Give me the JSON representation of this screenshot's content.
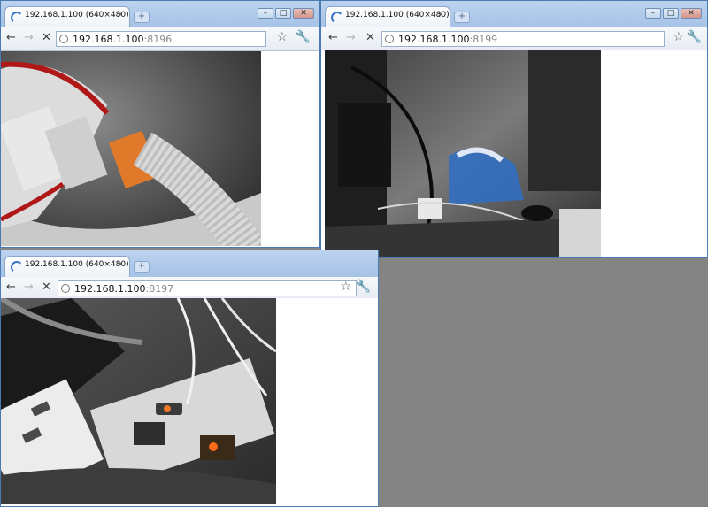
{
  "windows": [
    {
      "tab_title": "192.168.1.100 (640×480)",
      "tab_close": "×",
      "new_tab": "+",
      "url_host": "192.168.1.100",
      "url_port": ":8196",
      "icons": [
        "back-arrow-icon",
        "forward-arrow-icon",
        "stop-icon",
        "globe-icon",
        "star-icon",
        "wrench-icon"
      ]
    },
    {
      "tab_title": "192.168.1.100 (640×480)",
      "tab_close": "×",
      "new_tab": "+",
      "url_host": "192.168.1.100",
      "url_port": ":8199",
      "icons": [
        "back-arrow-icon",
        "forward-arrow-icon",
        "stop-icon",
        "globe-icon",
        "star-icon",
        "wrench-icon"
      ]
    },
    {
      "tab_title": "192.168.1.100 (640×480)",
      "tab_close": "×",
      "new_tab": "+",
      "url_host": "192.168.1.100",
      "url_port": ":8197",
      "icons": [
        "back-arrow-icon",
        "forward-arrow-icon",
        "stop-icon",
        "globe-icon",
        "star-icon",
        "wrench-icon"
      ]
    }
  ],
  "window_controls": [
    "minimize-icon",
    "maximize-icon",
    "close-icon"
  ],
  "colors": {
    "desktop": "#848484",
    "frame": "#a6c2e6",
    "loading_spinner": "#3a74c8"
  }
}
